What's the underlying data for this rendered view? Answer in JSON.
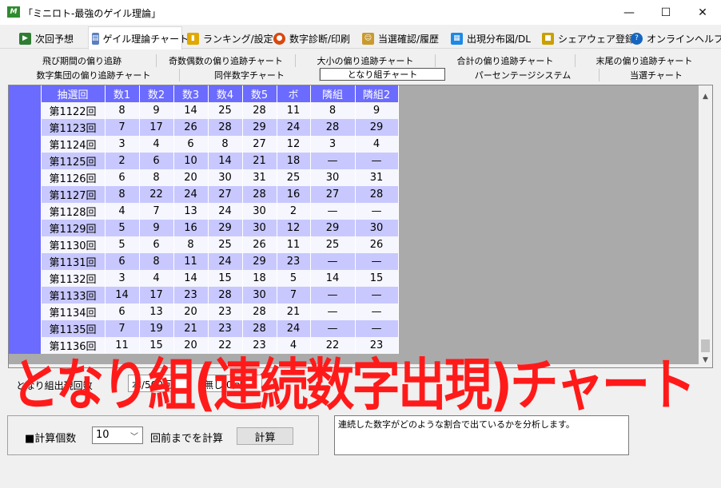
{
  "window": {
    "title": "「ミニロト-最強のゲイル理論」",
    "app_icon": "M",
    "minimize": "—",
    "maximize": "☐",
    "close": "✕"
  },
  "main_tabs": [
    {
      "label": "次回予想",
      "icon": "prediction-icon",
      "color": "#2e7d32"
    },
    {
      "label": "ゲイル理論チャート",
      "icon": "chart-icon",
      "color": "#5a7fbf"
    },
    {
      "label": "ランキング/設定",
      "icon": "ranking-icon",
      "color": "#e0a800"
    },
    {
      "label": "数字診断/印刷",
      "icon": "diagnosis-icon",
      "color": "#d9480f"
    },
    {
      "label": "当選確認/履歴",
      "icon": "history-icon",
      "color": "#c99a2e"
    },
    {
      "label": "出現分布図/DL",
      "icon": "distribution-icon",
      "color": "#1e88e5"
    },
    {
      "label": "シェアウェア登録",
      "icon": "lock-icon",
      "color": "#c9a000"
    },
    {
      "label": "オンラインヘルプ",
      "icon": "help-icon",
      "color": "#1565c0"
    }
  ],
  "sub_tabs_row1": [
    "飛び期間の偏り追跡",
    "奇数偶数の偏り追跡チャート",
    "大小の偏り追跡チャート",
    "合計の偏り追跡チャート",
    "末尾の偏り追跡チャート"
  ],
  "sub_tabs_row2": [
    "数字集団の偏り追跡チャート",
    "同伴数字チャート",
    "となり組チャート",
    "パーセンテージシステム",
    "当選チャート"
  ],
  "table": {
    "headers": [
      "抽選回",
      "数1",
      "数2",
      "数3",
      "数4",
      "数5",
      "ボ",
      "隣組",
      "隣組2"
    ],
    "rows": [
      [
        "第1122回",
        "8",
        "9",
        "14",
        "25",
        "28",
        "11",
        "8",
        "9"
      ],
      [
        "第1123回",
        "7",
        "17",
        "26",
        "28",
        "29",
        "24",
        "28",
        "29"
      ],
      [
        "第1124回",
        "3",
        "4",
        "6",
        "8",
        "27",
        "12",
        "3",
        "4"
      ],
      [
        "第1125回",
        "2",
        "6",
        "10",
        "14",
        "21",
        "18",
        "—",
        "—"
      ],
      [
        "第1126回",
        "6",
        "8",
        "20",
        "30",
        "31",
        "25",
        "30",
        "31"
      ],
      [
        "第1127回",
        "8",
        "22",
        "24",
        "27",
        "28",
        "16",
        "27",
        "28"
      ],
      [
        "第1128回",
        "4",
        "7",
        "13",
        "24",
        "30",
        "2",
        "—",
        "—"
      ],
      [
        "第1129回",
        "5",
        "9",
        "16",
        "29",
        "30",
        "12",
        "29",
        "30"
      ],
      [
        "第1130回",
        "5",
        "6",
        "8",
        "25",
        "26",
        "11",
        "25",
        "26"
      ],
      [
        "第1131回",
        "6",
        "8",
        "11",
        "24",
        "29",
        "23",
        "—",
        "—"
      ],
      [
        "第1132回",
        "3",
        "4",
        "14",
        "15",
        "18",
        "5",
        "14",
        "15"
      ],
      [
        "第1133回",
        "14",
        "17",
        "23",
        "28",
        "30",
        "7",
        "—",
        "—"
      ],
      [
        "第1134回",
        "6",
        "13",
        "20",
        "23",
        "28",
        "21",
        "—",
        "—"
      ],
      [
        "第1135回",
        "7",
        "19",
        "21",
        "23",
        "28",
        "24",
        "—",
        "—"
      ],
      [
        "第1136回",
        "11",
        "15",
        "20",
        "22",
        "23",
        "4",
        "22",
        "23"
      ]
    ]
  },
  "options": {
    "label": "となり組出現回数",
    "value1": "本/500回",
    "value2": "無し/0回"
  },
  "overlay_caption": "となり組(連続数字出現)チャート",
  "calc": {
    "label": "■計算個数",
    "select_value": "10",
    "suffix": "回前までを計算",
    "button": "計算"
  },
  "description": "連続した数字がどのような割合で出ているかを分析します。",
  "colors": {
    "header_bg": "#6b6bff",
    "row_light": "#f6f6ff",
    "row_dark": "#c8c8ff",
    "overlay_red": "#ff1a1a"
  }
}
